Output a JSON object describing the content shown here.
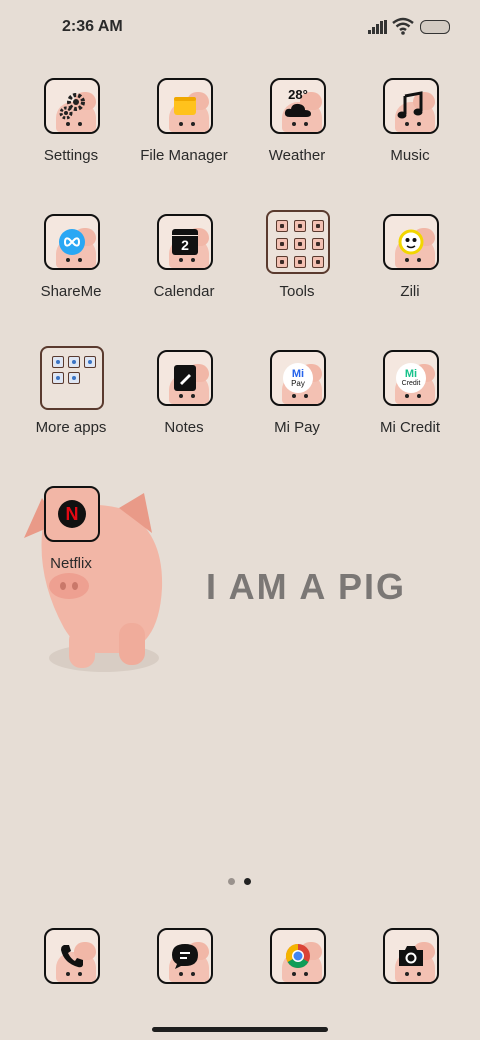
{
  "status_bar": {
    "time": "2:36 AM",
    "icons": [
      "signal-icon",
      "wifi-icon",
      "battery-icon"
    ]
  },
  "apps": [
    {
      "label": "Settings",
      "icon": "gear-icon"
    },
    {
      "label": "File Manager",
      "icon": "folder-icon"
    },
    {
      "label": "Weather",
      "icon": "cloud-icon",
      "temp": "28°"
    },
    {
      "label": "Music",
      "icon": "music-note-icon"
    },
    {
      "label": "ShareMe",
      "icon": "infinity-icon"
    },
    {
      "label": "Calendar",
      "icon": "calendar-icon",
      "day": "2"
    },
    {
      "label": "Tools",
      "icon": "folder-grid-icon"
    },
    {
      "label": "Zili",
      "icon": "zili-face-icon"
    },
    {
      "label": "More apps",
      "icon": "folder-grid-icon"
    },
    {
      "label": "Notes",
      "icon": "notes-icon"
    },
    {
      "label": "Mi Pay",
      "icon": "mi-pay-icon",
      "badge": "Pay"
    },
    {
      "label": "Mi Credit",
      "icon": "mi-credit-icon",
      "badge": "Credit"
    },
    {
      "label": "Netflix",
      "icon": "netflix-icon",
      "badge": "N"
    }
  ],
  "wallpaper": {
    "tagline": "I AM A PIG"
  },
  "page_indicator": {
    "count": 2,
    "active": 2
  },
  "dock": [
    {
      "name": "phone",
      "icon": "phone-icon"
    },
    {
      "name": "messaging",
      "icon": "message-icon"
    },
    {
      "name": "chrome",
      "icon": "chrome-icon"
    },
    {
      "name": "camera",
      "icon": "camera-icon"
    }
  ],
  "colors": {
    "background": "#e6ddd5",
    "tile_border": "#111111",
    "pig_pink": "#f3c1b3",
    "tagline": "#7b7775",
    "netflix_red": "#e50914",
    "shareme_blue": "#2aa7f4",
    "file_yellow": "#ffc21c",
    "mi_green": "#17c28b",
    "mi_blue": "#2563eb"
  }
}
